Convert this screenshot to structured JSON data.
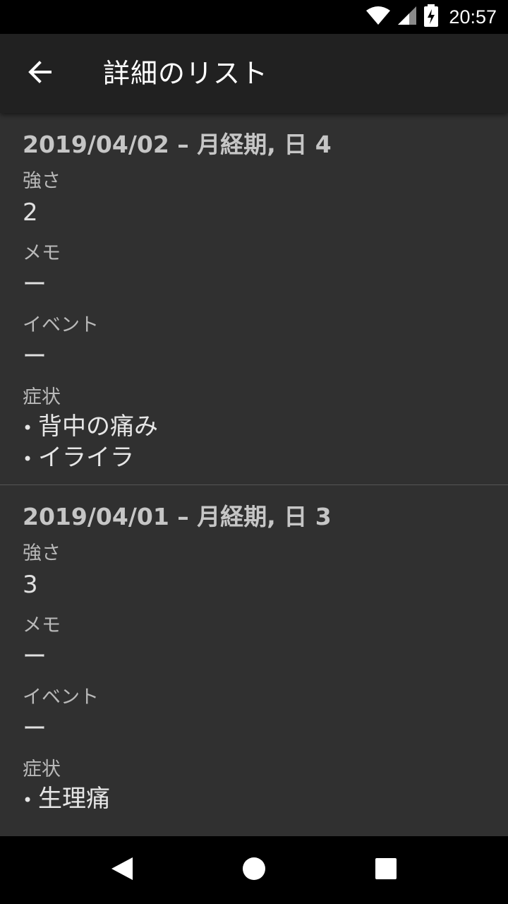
{
  "status_bar": {
    "time": "20:57",
    "icons": [
      "wifi-icon",
      "cellular-signal-icon",
      "battery-charging-icon"
    ]
  },
  "app_bar": {
    "back_icon": "arrow-back-icon",
    "title": "詳細のリスト"
  },
  "entries": [
    {
      "header": "2019/04/02 – 月経期, 日 4",
      "intensity_label": "強さ",
      "intensity_value": "2",
      "memo_label": "メモ",
      "memo_value": "ー",
      "event_label": "イベント",
      "event_value": "ー",
      "symptoms_label": "症状",
      "symptoms": [
        "背中の痛み",
        "イライラ"
      ]
    },
    {
      "header": "2019/04/01 – 月経期, 日 3",
      "intensity_label": "強さ",
      "intensity_value": "3",
      "memo_label": "メモ",
      "memo_value": "ー",
      "event_label": "イベント",
      "event_value": "ー",
      "symptoms_label": "症状",
      "symptoms": [
        "生理痛"
      ]
    }
  ],
  "nav_bar": {
    "icons": [
      "back-triangle-icon",
      "home-circle-icon",
      "recents-square-icon"
    ]
  },
  "colors": {
    "background": "#303030",
    "app_bar": "#212121",
    "system_bars": "#000000"
  }
}
